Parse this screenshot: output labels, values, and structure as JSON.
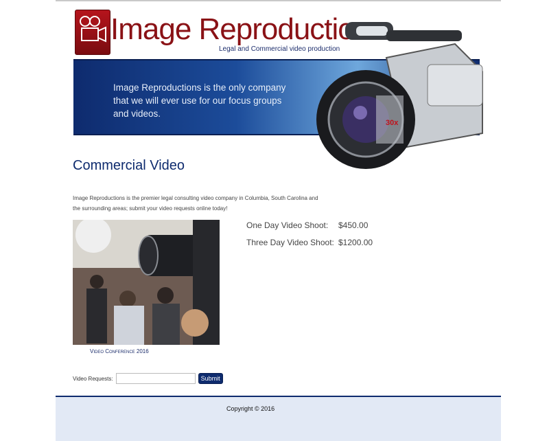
{
  "header": {
    "brand": "Image Reproductions",
    "tagline": "Legal and Commercial video production"
  },
  "banner": {
    "quote": "Image Reproductions is the only company that we will ever use for our focus groups and videos."
  },
  "main": {
    "title": "Commercial Video",
    "intro": "Image Reproductions is the premier legal consulting video company in Columbia, South Carolina and the surrounding areas; submit your video requests online today!",
    "photo_caption": "Video Conference 2016",
    "prices": [
      {
        "label": "One Day Video Shoot:",
        "price": "$450.00"
      },
      {
        "label": "Three Day Video Shoot:",
        "price": "$1200.00"
      }
    ]
  },
  "form": {
    "label": "Video Requests:",
    "value": "",
    "submit_label": "Submit"
  },
  "footer": {
    "copyright": "Copyright © 2016"
  },
  "colors": {
    "brand_red": "#8a1216",
    "navy": "#0e2b6e",
    "footer_bg": "#e2e9f5"
  }
}
